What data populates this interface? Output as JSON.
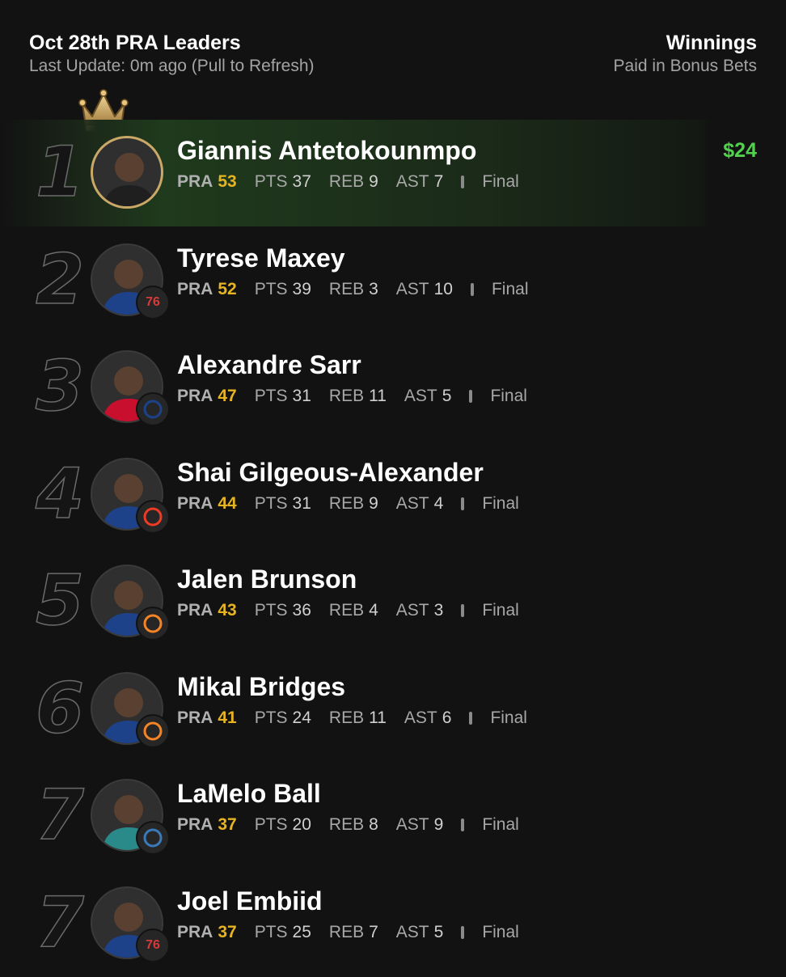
{
  "header": {
    "title": "Oct 28th PRA Leaders",
    "subtitle": "Last Update: 0m ago (Pull to Refresh)",
    "winnings_title": "Winnings",
    "winnings_subtitle": "Paid in Bonus Bets"
  },
  "labels": {
    "pra": "PRA",
    "pts": "PTS",
    "reb": "REB",
    "ast": "AST"
  },
  "colors": {
    "background": "#121212",
    "pra_value": "#e6b422",
    "winnings": "#52d14d",
    "leader_highlight": "#1f3a1d"
  },
  "leaders": [
    {
      "rank": "1",
      "name": "Giannis Antetokounmpo",
      "pra": "53",
      "pts": "37",
      "reb": "9",
      "ast": "7",
      "status": "Final",
      "winnings": "$24",
      "team": "",
      "team_icon": "bucks-logo-icon"
    },
    {
      "rank": "2",
      "name": "Tyrese Maxey",
      "pra": "52",
      "pts": "39",
      "reb": "3",
      "ast": "10",
      "status": "Final",
      "team": "76",
      "team_icon": "sixers-logo-icon"
    },
    {
      "rank": "3",
      "name": "Alexandre Sarr",
      "pra": "47",
      "pts": "31",
      "reb": "11",
      "ast": "5",
      "status": "Final",
      "team": "",
      "team_icon": "wizards-logo-icon"
    },
    {
      "rank": "4",
      "name": "Shai Gilgeous-Alexander",
      "pra": "44",
      "pts": "31",
      "reb": "9",
      "ast": "4",
      "status": "Final",
      "team": "",
      "team_icon": "thunder-logo-icon"
    },
    {
      "rank": "5",
      "name": "Jalen Brunson",
      "pra": "43",
      "pts": "36",
      "reb": "4",
      "ast": "3",
      "status": "Final",
      "team": "",
      "team_icon": "knicks-logo-icon"
    },
    {
      "rank": "6",
      "name": "Mikal Bridges",
      "pra": "41",
      "pts": "24",
      "reb": "11",
      "ast": "6",
      "status": "Final",
      "team": "",
      "team_icon": "knicks-logo-icon"
    },
    {
      "rank": "7",
      "name": "LaMelo Ball",
      "pra": "37",
      "pts": "20",
      "reb": "8",
      "ast": "9",
      "status": "Final",
      "team": "",
      "team_icon": "hornets-logo-icon"
    },
    {
      "rank": "7",
      "name": "Joel Embiid",
      "pra": "37",
      "pts": "25",
      "reb": "7",
      "ast": "5",
      "status": "Final",
      "team": "76",
      "team_icon": "sixers-logo-icon"
    }
  ]
}
